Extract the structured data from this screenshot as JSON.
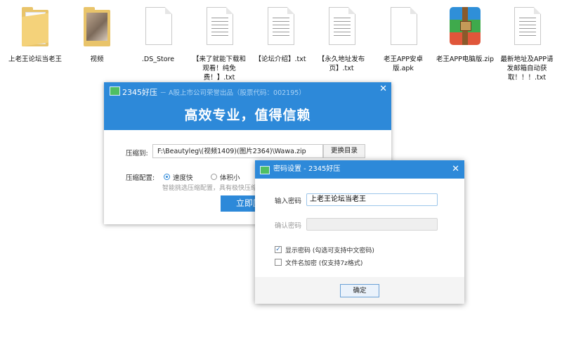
{
  "desktop": {
    "files": [
      {
        "name": "上老王论坛当老王",
        "icon": "folder-icon"
      },
      {
        "name": "视频",
        "icon": "folder-photo-icon"
      },
      {
        "name": ".DS_Store",
        "icon": "document-icon"
      },
      {
        "name": "【来了就能下载和观看！纯免费！】.txt",
        "icon": "text-file-icon"
      },
      {
        "name": "【论坛介绍】.txt",
        "icon": "text-file-icon"
      },
      {
        "name": "【永久地址发布页】.txt",
        "icon": "text-file-icon"
      },
      {
        "name": "老王APP安卓版.apk",
        "icon": "document-icon"
      },
      {
        "name": "老王APP电脑版.zip",
        "icon": "zip-archive-icon"
      },
      {
        "name": "最新地址及APP请发邮箱自动获取！！！.txt",
        "icon": "text-file-icon"
      }
    ]
  },
  "compress_window": {
    "title": "2345好压",
    "subtitle": "－ A股上市公司荣誉出品（股票代码：002195）",
    "slogan": "高效专业，值得信赖",
    "compress_to_label": "压缩到:",
    "compress_path": "F:\\Beautyleg\\(视频1409)(图片2364)\\Wawa.zip",
    "change_dir_button": "更换目录",
    "config_label": "压缩配置:",
    "option_fast": "速度快",
    "option_small": "体积小",
    "hint": "智能挑选压缩配置，具有极快压缩",
    "compress_button": "立即压"
  },
  "password_dialog": {
    "title": "密码设置 - 2345好压",
    "enter_label": "输入密码",
    "enter_value": "上老王论坛当老王",
    "confirm_label": "确认密码",
    "confirm_value": "",
    "show_password_label": "显示密码 (勾选可支持中文密码)",
    "show_password_checked": true,
    "encrypt_names_label": "文件名加密 (仅支持7z格式)",
    "encrypt_names_checked": false,
    "ok_button": "确定"
  },
  "colors": {
    "accent": "#2d89d9",
    "folder": "#e9c46a"
  }
}
